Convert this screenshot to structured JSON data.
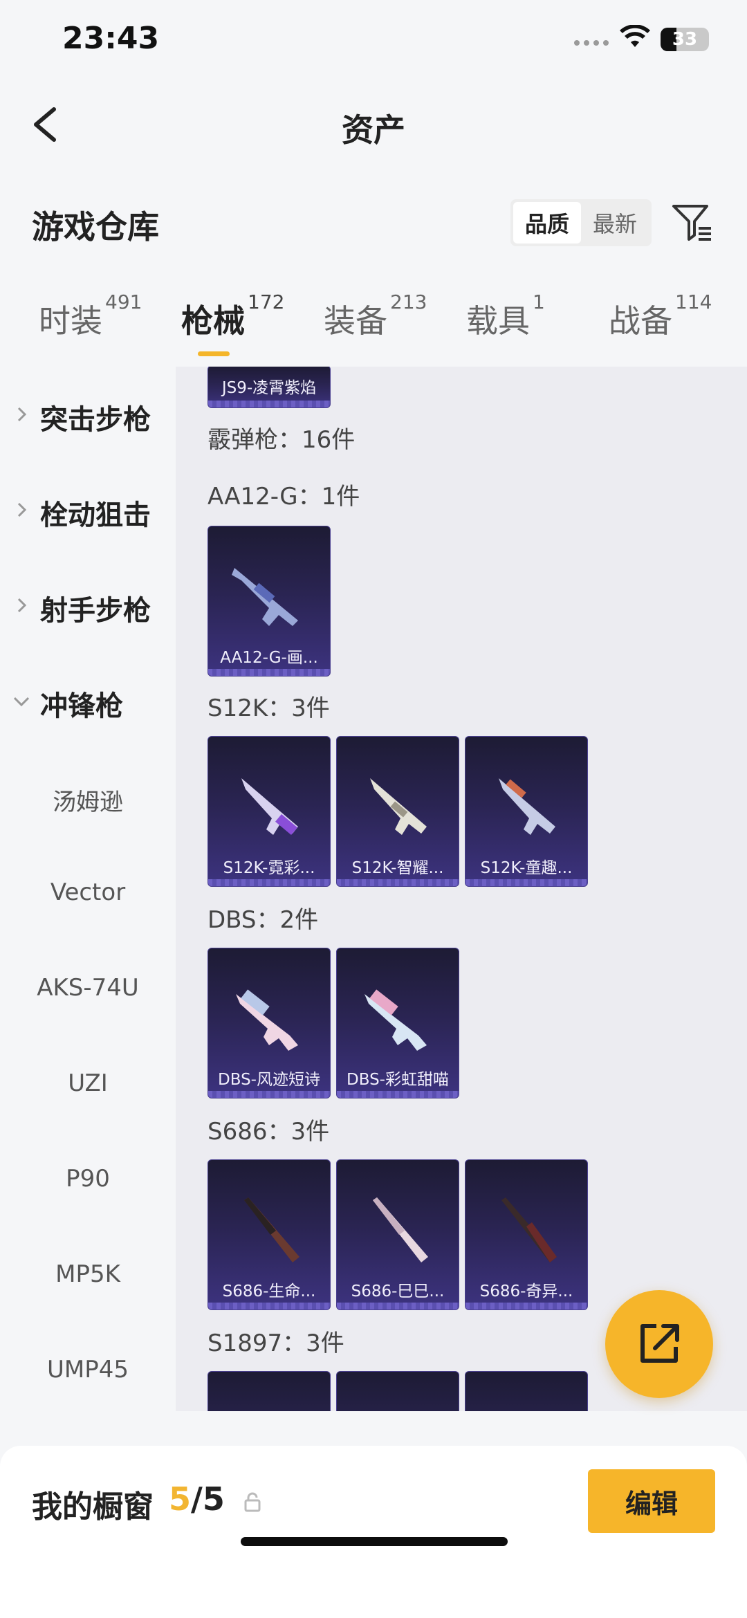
{
  "status_bar": {
    "time": "23:43",
    "battery": "33",
    "battery_fraction": 0.33
  },
  "nav": {
    "title": "资产"
  },
  "warehouse": {
    "title": "游戏仓库",
    "sort_options": [
      "品质",
      "最新"
    ],
    "sort_selected": "品质"
  },
  "tabs": [
    {
      "label": "时装",
      "count": "491"
    },
    {
      "label": "枪械",
      "count": "172",
      "active": true
    },
    {
      "label": "装备",
      "count": "213"
    },
    {
      "label": "载具",
      "count": "1"
    },
    {
      "label": "战备",
      "count": "114"
    }
  ],
  "sidebar": {
    "categories": [
      "突击步枪",
      "栓动狙击",
      "射手步枪",
      "冲锋枪"
    ],
    "subitems": [
      "汤姆逊",
      "Vector",
      "AKS-74U",
      "UZI",
      "P90",
      "MP5K",
      "UMP45"
    ]
  },
  "content": {
    "top_card": "JS9-凌霄紫焰",
    "section_label": "霰弹枪：16件",
    "groups": [
      {
        "label": "AA12-G：1件",
        "items": [
          "AA12-G-画..."
        ]
      },
      {
        "label": "S12K：3件",
        "items": [
          "S12K-霓彩...",
          "S12K-智耀...",
          "S12K-童趣..."
        ]
      },
      {
        "label": "DBS：2件",
        "items": [
          "DBS-风迹短诗",
          "DBS-彩虹甜喵"
        ]
      },
      {
        "label": "S686：3件",
        "items": [
          "S686-生命...",
          "S686-巳巳...",
          "S686-奇异..."
        ]
      },
      {
        "label": "S1897：3件",
        "items": [
          "",
          "",
          ""
        ]
      }
    ]
  },
  "bottom": {
    "showcase_label": "我的橱窗",
    "showcase_current": "5",
    "showcase_sep_total": "/5",
    "edit_label": "编辑"
  },
  "colors": {
    "accent": "#f6b52a",
    "card_bg": "#2a2452"
  }
}
